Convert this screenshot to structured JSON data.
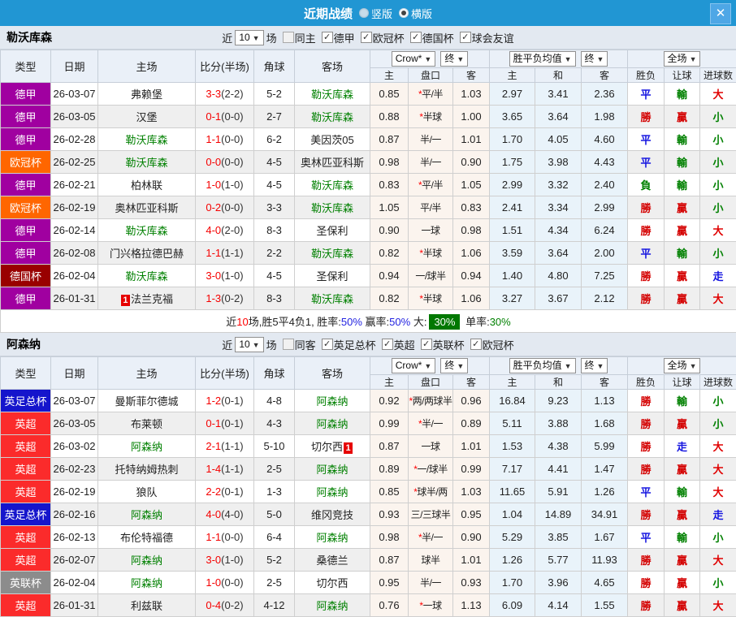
{
  "titlebar": {
    "title": "近期战绩",
    "vertical": "竖版",
    "horizontal": "横版",
    "close": "✕"
  },
  "icons": {
    "check": "✓",
    "arrow": "▼",
    "close": "✕"
  },
  "head": {
    "cols": [
      "类型",
      "日期",
      "主场",
      "比分(半场)",
      "角球",
      "客场"
    ],
    "sub": [
      "主",
      "盘口",
      "客",
      "主",
      "和",
      "客",
      "胜负",
      "让球",
      "进球数"
    ],
    "select_book": "Crow*",
    "select_final": "终",
    "select_avg": "胜平负均值",
    "select_scope": "全场"
  },
  "type_colors": {
    "德甲": "#a000a0",
    "欧冠杯": "#ff6600",
    "德国杯": "#990000",
    "英足总杯": "#1515cc",
    "英超": "#fb2b2b",
    "英联杯": "#8c8c8c"
  },
  "mark_colors": {
    "勝": "#d40000",
    "平": "#1414e0",
    "負": "#008000",
    "贏": "#d40000",
    "輸": "#008000",
    "走": "#1414e0",
    "大": "#e00000",
    "小": "#008000"
  },
  "sections": [
    {
      "team": "勒沃库森",
      "filter": {
        "near": "近",
        "count": "10",
        "games": "场",
        "same": "同主",
        "leagues": [
          "德甲",
          "欧冠杯",
          "德国杯",
          "球会友谊"
        ]
      },
      "rows": [
        {
          "lg": "德甲",
          "dt": "26-03-07",
          "hm": "弗赖堡",
          "hg": false,
          "hc": null,
          "ft": "3-3",
          "ht": "(2-2)",
          "cn": "5-2",
          "aw": "勒沃库森",
          "ag": true,
          "ac": null,
          "h": "0.85",
          "p": "*平/半",
          "a": "1.03",
          "w": "2.97",
          "d": "3.41",
          "l": "2.36",
          "r": "平",
          "lt": "輸",
          "gl": "大"
        },
        {
          "lg": "德甲",
          "dt": "26-03-05",
          "hm": "汉堡",
          "hg": false,
          "hc": null,
          "ft": "0-1",
          "ht": "(0-0)",
          "cn": "2-7",
          "aw": "勒沃库森",
          "ag": true,
          "ac": null,
          "h": "0.88",
          "p": "*半球",
          "a": "1.00",
          "w": "3.65",
          "d": "3.64",
          "l": "1.98",
          "r": "勝",
          "lt": "贏",
          "gl": "小"
        },
        {
          "lg": "德甲",
          "dt": "26-02-28",
          "hm": "勒沃库森",
          "hg": true,
          "hc": null,
          "ft": "1-1",
          "ht": "(0-0)",
          "cn": "6-2",
          "aw": "美因茨05",
          "ag": false,
          "ac": null,
          "h": "0.87",
          "p": "半/一",
          "a": "1.01",
          "w": "1.70",
          "d": "4.05",
          "l": "4.60",
          "r": "平",
          "lt": "輸",
          "gl": "小"
        },
        {
          "lg": "欧冠杯",
          "dt": "26-02-25",
          "hm": "勒沃库森",
          "hg": true,
          "hc": null,
          "ft": "0-0",
          "ht": "(0-0)",
          "cn": "4-5",
          "aw": "奥林匹亚科斯",
          "ag": false,
          "ac": null,
          "h": "0.98",
          "p": "半/一",
          "a": "0.90",
          "w": "1.75",
          "d": "3.98",
          "l": "4.43",
          "r": "平",
          "lt": "輸",
          "gl": "小"
        },
        {
          "lg": "德甲",
          "dt": "26-02-21",
          "hm": "柏林联",
          "hg": false,
          "hc": null,
          "ft": "1-0",
          "ht": "(1-0)",
          "cn": "4-5",
          "aw": "勒沃库森",
          "ag": true,
          "ac": null,
          "h": "0.83",
          "p": "*平/半",
          "a": "1.05",
          "w": "2.99",
          "d": "3.32",
          "l": "2.40",
          "r": "負",
          "lt": "輸",
          "gl": "小"
        },
        {
          "lg": "欧冠杯",
          "dt": "26-02-19",
          "hm": "奥林匹亚科斯",
          "hg": false,
          "hc": null,
          "ft": "0-2",
          "ht": "(0-0)",
          "cn": "3-3",
          "aw": "勒沃库森",
          "ag": true,
          "ac": null,
          "h": "1.05",
          "p": "平/半",
          "a": "0.83",
          "w": "2.41",
          "d": "3.34",
          "l": "2.99",
          "r": "勝",
          "lt": "贏",
          "gl": "小"
        },
        {
          "lg": "德甲",
          "dt": "26-02-14",
          "hm": "勒沃库森",
          "hg": true,
          "hc": null,
          "ft": "4-0",
          "ht": "(2-0)",
          "cn": "8-3",
          "aw": "圣保利",
          "ag": false,
          "ac": null,
          "h": "0.90",
          "p": "一球",
          "a": "0.98",
          "w": "1.51",
          "d": "4.34",
          "l": "6.24",
          "r": "勝",
          "lt": "贏",
          "gl": "大"
        },
        {
          "lg": "德甲",
          "dt": "26-02-08",
          "hm": "门兴格拉德巴赫",
          "hg": false,
          "hc": null,
          "ft": "1-1",
          "ht": "(1-1)",
          "cn": "2-2",
          "aw": "勒沃库森",
          "ag": true,
          "ac": null,
          "h": "0.82",
          "p": "*半球",
          "a": "1.06",
          "w": "3.59",
          "d": "3.64",
          "l": "2.00",
          "r": "平",
          "lt": "輸",
          "gl": "小"
        },
        {
          "lg": "德国杯",
          "dt": "26-02-04",
          "hm": "勒沃库森",
          "hg": true,
          "hc": null,
          "ft": "3-0",
          "ht": "(1-0)",
          "cn": "4-5",
          "aw": "圣保利",
          "ag": false,
          "ac": null,
          "h": "0.94",
          "p": "一/球半",
          "a": "0.94",
          "w": "1.40",
          "d": "4.80",
          "l": "7.25",
          "r": "勝",
          "lt": "贏",
          "gl": "走"
        },
        {
          "lg": "德甲",
          "dt": "26-01-31",
          "hm": "法兰克福",
          "hg": false,
          "hc": {
            "v": "1",
            "pos": "before"
          },
          "ft": "1-3",
          "ht": "(0-2)",
          "cn": "8-3",
          "aw": "勒沃库森",
          "ag": true,
          "ac": null,
          "h": "0.82",
          "p": "*半球",
          "a": "1.06",
          "w": "3.27",
          "d": "3.67",
          "l": "2.12",
          "r": "勝",
          "lt": "贏",
          "gl": "大"
        }
      ],
      "summary": [
        {
          "t": "近",
          "c": "k"
        },
        {
          "t": "10",
          "c": "r"
        },
        {
          "t": "场,胜5平4负1, 胜率:",
          "c": "k"
        },
        {
          "t": "50%",
          "c": "b"
        },
        {
          "t": " 赢率:",
          "c": "k"
        },
        {
          "t": "50%",
          "c": "b"
        },
        {
          "t": " 大:",
          "c": "k"
        },
        {
          "t": "30%",
          "c": "badge30"
        },
        {
          "t": " 单率:",
          "c": "k"
        },
        {
          "t": "30%",
          "c": "g"
        }
      ]
    },
    {
      "team": "阿森纳",
      "filter": {
        "near": "近",
        "count": "10",
        "games": "场",
        "same": "同客",
        "leagues": [
          "英足总杯",
          "英超",
          "英联杯",
          "欧冠杯"
        ]
      },
      "rows": [
        {
          "lg": "英足总杯",
          "dt": "26-03-07",
          "hm": "曼斯菲尔德城",
          "hg": false,
          "hc": null,
          "ft": "1-2",
          "ht": "(0-1)",
          "cn": "4-8",
          "aw": "阿森纳",
          "ag": true,
          "ac": null,
          "h": "0.92",
          "p": "*两/两球半",
          "a": "0.96",
          "w": "16.84",
          "d": "9.23",
          "l": "1.13",
          "r": "勝",
          "lt": "輸",
          "gl": "小"
        },
        {
          "lg": "英超",
          "dt": "26-03-05",
          "hm": "布莱顿",
          "hg": false,
          "hc": null,
          "ft": "0-1",
          "ht": "(0-1)",
          "cn": "4-3",
          "aw": "阿森纳",
          "ag": true,
          "ac": null,
          "h": "0.99",
          "p": "*半/一",
          "a": "0.89",
          "w": "5.11",
          "d": "3.88",
          "l": "1.68",
          "r": "勝",
          "lt": "贏",
          "gl": "小"
        },
        {
          "lg": "英超",
          "dt": "26-03-02",
          "hm": "阿森纳",
          "hg": true,
          "hc": null,
          "ft": "2-1",
          "ht": "(1-1)",
          "cn": "5-10",
          "aw": "切尔西",
          "ag": false,
          "ac": {
            "v": "1",
            "pos": "after"
          },
          "h": "0.87",
          "p": "一球",
          "a": "1.01",
          "w": "1.53",
          "d": "4.38",
          "l": "5.99",
          "r": "勝",
          "lt": "走",
          "gl": "大"
        },
        {
          "lg": "英超",
          "dt": "26-02-23",
          "hm": "托特纳姆热刺",
          "hg": false,
          "hc": null,
          "ft": "1-4",
          "ht": "(1-1)",
          "cn": "2-5",
          "aw": "阿森纳",
          "ag": true,
          "ac": null,
          "h": "0.89",
          "p": "*一/球半",
          "a": "0.99",
          "w": "7.17",
          "d": "4.41",
          "l": "1.47",
          "r": "勝",
          "lt": "贏",
          "gl": "大"
        },
        {
          "lg": "英超",
          "dt": "26-02-19",
          "hm": "狼队",
          "hg": false,
          "hc": null,
          "ft": "2-2",
          "ht": "(0-1)",
          "cn": "1-3",
          "aw": "阿森纳",
          "ag": true,
          "ac": null,
          "h": "0.85",
          "p": "*球半/两",
          "a": "1.03",
          "w": "11.65",
          "d": "5.91",
          "l": "1.26",
          "r": "平",
          "lt": "輸",
          "gl": "大"
        },
        {
          "lg": "英足总杯",
          "dt": "26-02-16",
          "hm": "阿森纳",
          "hg": true,
          "hc": null,
          "ft": "4-0",
          "ht": "(4-0)",
          "cn": "5-0",
          "aw": "维冈竞技",
          "ag": false,
          "ac": null,
          "h": "0.93",
          "p": "三/三球半",
          "a": "0.95",
          "w": "1.04",
          "d": "14.89",
          "l": "34.91",
          "r": "勝",
          "lt": "贏",
          "gl": "走"
        },
        {
          "lg": "英超",
          "dt": "26-02-13",
          "hm": "布伦特福德",
          "hg": false,
          "hc": null,
          "ft": "1-1",
          "ht": "(0-0)",
          "cn": "6-4",
          "aw": "阿森纳",
          "ag": true,
          "ac": null,
          "h": "0.98",
          "p": "*半/一",
          "a": "0.90",
          "w": "5.29",
          "d": "3.85",
          "l": "1.67",
          "r": "平",
          "lt": "輸",
          "gl": "小"
        },
        {
          "lg": "英超",
          "dt": "26-02-07",
          "hm": "阿森纳",
          "hg": true,
          "hc": null,
          "ft": "3-0",
          "ht": "(1-0)",
          "cn": "5-2",
          "aw": "桑德兰",
          "ag": false,
          "ac": null,
          "h": "0.87",
          "p": "球半",
          "a": "1.01",
          "w": "1.26",
          "d": "5.77",
          "l": "11.93",
          "r": "勝",
          "lt": "贏",
          "gl": "大"
        },
        {
          "lg": "英联杯",
          "dt": "26-02-04",
          "hm": "阿森纳",
          "hg": true,
          "hc": null,
          "ft": "1-0",
          "ht": "(0-0)",
          "cn": "2-5",
          "aw": "切尔西",
          "ag": false,
          "ac": null,
          "h": "0.95",
          "p": "半/一",
          "a": "0.93",
          "w": "1.70",
          "d": "3.96",
          "l": "4.65",
          "r": "勝",
          "lt": "贏",
          "gl": "小"
        },
        {
          "lg": "英超",
          "dt": "26-01-31",
          "hm": "利兹联",
          "hg": false,
          "hc": null,
          "ft": "0-4",
          "ht": "(0-2)",
          "cn": "4-12",
          "aw": "阿森纳",
          "ag": true,
          "ac": null,
          "h": "0.76",
          "p": "*一球",
          "a": "1.13",
          "w": "6.09",
          "d": "4.14",
          "l": "1.55",
          "r": "勝",
          "lt": "贏",
          "gl": "大"
        }
      ],
      "summary": null
    }
  ]
}
